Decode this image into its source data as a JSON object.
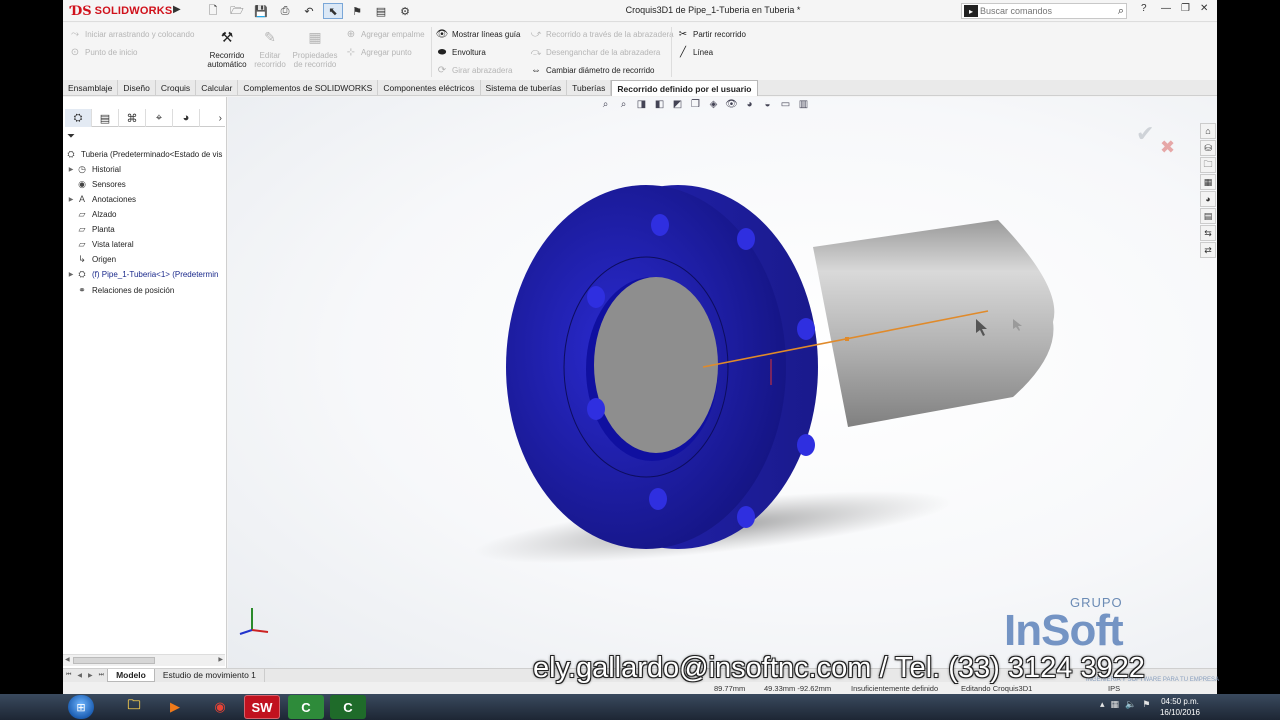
{
  "titlebar": {
    "brand": "SOLIDWORKS",
    "doc_title": "Croquis3D1 de Pipe_1-Tuberia en Tuberia *",
    "search_placeholder": "Buscar comandos",
    "help": "?"
  },
  "cmdmgr": {
    "items": [
      {
        "label": "Iniciar arrastrando y colocando",
        "enabled": false
      },
      {
        "label": "Punto de inicio",
        "enabled": false
      },
      {
        "label": "Recorrido automático",
        "enabled": true
      },
      {
        "label": "Editar recorrido",
        "enabled": false
      },
      {
        "label": "Propiedades de recorrido",
        "enabled": false
      },
      {
        "label": "Agregar empalme",
        "enabled": false
      },
      {
        "label": "Agregar punto",
        "enabled": false
      },
      {
        "label": "Mostrar líneas guía",
        "enabled": true
      },
      {
        "label": "Envoltura",
        "enabled": true
      },
      {
        "label": "Girar abrazadera",
        "enabled": false
      },
      {
        "label": "Recorrido a través de la abrazadera",
        "enabled": false
      },
      {
        "label": "Desenganchar de la abrazadera",
        "enabled": false
      },
      {
        "label": "Cambiar diámetro de recorrido",
        "enabled": true
      },
      {
        "label": "Partir recorrido",
        "enabled": true
      },
      {
        "label": "Línea",
        "enabled": true
      }
    ]
  },
  "tabs": [
    "Ensamblaje",
    "Diseño",
    "Croquis",
    "Calcular",
    "Complementos de SOLIDWORKS",
    "Componentes eléctricos",
    "Sistema de tuberías",
    "Tuberías",
    "Recorrido definido por el usuario"
  ],
  "active_tab": "Recorrido definido por el usuario",
  "tree": {
    "root": "Tuberia  (Predeterminado<Estado de vis",
    "items": [
      {
        "label": "Historial",
        "expandable": true
      },
      {
        "label": "Sensores",
        "expandable": false
      },
      {
        "label": "Anotaciones",
        "expandable": true
      },
      {
        "label": "Alzado",
        "expandable": false
      },
      {
        "label": "Planta",
        "expandable": false
      },
      {
        "label": "Vista lateral",
        "expandable": false
      },
      {
        "label": "Origen",
        "expandable": false
      },
      {
        "label": "(f) Pipe_1-Tuberia<1> (Predetermin",
        "expandable": true
      },
      {
        "label": "Relaciones de posición",
        "expandable": false
      }
    ]
  },
  "bottom_tabs": [
    "Modelo",
    "Estudio de movimiento 1"
  ],
  "active_bottom_tab": "Modelo",
  "status": {
    "length": "89.77mm",
    "coords": "49.33mm -92.62mm",
    "definition": "Insuficientemente definido",
    "mode": "Editando Croquis3D1",
    "units": "IPS"
  },
  "watermark": {
    "grupo": "GRUPO",
    "brand": "InSoft",
    "tagline": "INGENIERÍA Y SOFTWARE PARA TU EMPRESA"
  },
  "overlay_email": "ely.gallardo@insoftnc.com / Tel. (33) 3124 3922",
  "taskbar": {
    "time": "04:50 p.m.",
    "date": "16/10/2016"
  },
  "model_colors": {
    "flange": "#1f1fa8",
    "pipe": "#b8b8b8",
    "sketch_line": "#e08a2a"
  }
}
